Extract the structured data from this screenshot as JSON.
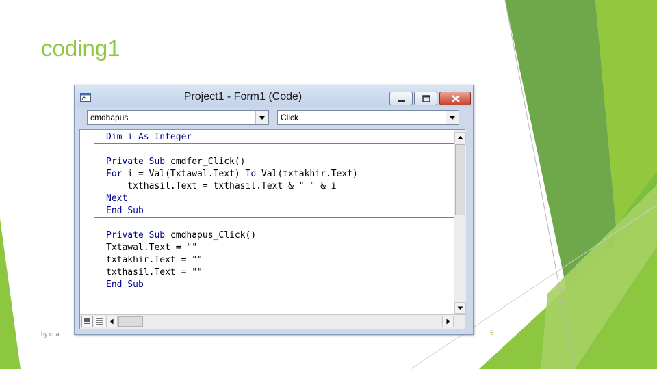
{
  "slide": {
    "title": "coding1",
    "footer_left": "by cha",
    "page_number": "6",
    "accent_color": "#8dc63f"
  },
  "window": {
    "title": "Project1 - Form1 (Code)",
    "icon": "vb-code-window-icon",
    "buttons": {
      "minimize": "minimize-icon",
      "maximize": "maximize-icon",
      "close": "close-icon"
    }
  },
  "object_combo": {
    "value": "cmdhapus"
  },
  "procedure_combo": {
    "value": "Click"
  },
  "code": {
    "lines": [
      [
        {
          "t": "Dim i As Integer",
          "k": true
        }
      ],
      [],
      [
        {
          "t": "Private Sub ",
          "k": true
        },
        {
          "t": "cmdfor_Click()",
          "k": false
        }
      ],
      [
        {
          "t": "For",
          "k": true
        },
        {
          "t": " i = Val(Txtawal.Text) ",
          "k": false
        },
        {
          "t": "To",
          "k": true
        },
        {
          "t": " Val(txtakhir.Text)",
          "k": false
        }
      ],
      [
        {
          "t": "    txthasil.Text = txthasil.Text & \" \" & i",
          "k": false
        }
      ],
      [
        {
          "t": "Next",
          "k": true
        }
      ],
      [
        {
          "t": "End Sub",
          "k": true
        }
      ],
      [],
      [
        {
          "t": "Private Sub ",
          "k": true
        },
        {
          "t": "cmdhapus_Click()",
          "k": false
        }
      ],
      [
        {
          "t": "Txtawal.Text = \"\"",
          "k": false
        }
      ],
      [
        {
          "t": "txtakhir.Text = \"\"",
          "k": false
        }
      ],
      [
        {
          "t": "txthasil.Text = \"\"",
          "k": false,
          "cursor": true
        }
      ],
      [
        {
          "t": "End Sub",
          "k": true
        }
      ]
    ],
    "keyword_color": "#00008b"
  }
}
